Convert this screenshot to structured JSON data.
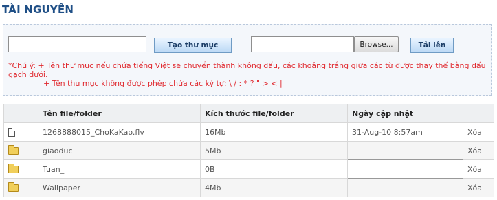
{
  "page": {
    "title": "TÀI NGUYÊN"
  },
  "toolbar": {
    "folder_input_value": "",
    "create_folder_label": "Tạo thư mục",
    "file_input_value": "",
    "browse_label": "Browse...",
    "upload_label": "Tải lên"
  },
  "notes": {
    "line1": "*Chú ý: + Tên thư mục nếu chứa tiếng Việt sẽ chuyển thành không dấu, các khoảng trắng giữa các từ được thay thế bằng dấu gạch dưới.",
    "line2": "+ Tên thư mục không được phép chứa các ký tự: \\ / : * ? \" > < |"
  },
  "table": {
    "headers": {
      "icon": "",
      "name": "Tên file/folder",
      "size": "Kích thước file/folder",
      "date": "Ngày cập nhật",
      "action": ""
    },
    "rows": [
      {
        "icon": "file-icon",
        "name": "1268888015_ChoKaKao.flv",
        "size": "16Mb",
        "date": "31-Aug-10 8:57am",
        "action": "Xóa"
      },
      {
        "icon": "folder-icon",
        "name": "giaoduc",
        "size": "5Mb",
        "date": "",
        "action": "Xóa"
      },
      {
        "icon": "folder-icon",
        "name": "Tuan_",
        "size": "0B",
        "date": "",
        "action": "Xóa"
      },
      {
        "icon": "folder-icon",
        "name": "Wallpaper",
        "size": "4Mb",
        "date": "",
        "action": "Xóa"
      }
    ]
  }
}
